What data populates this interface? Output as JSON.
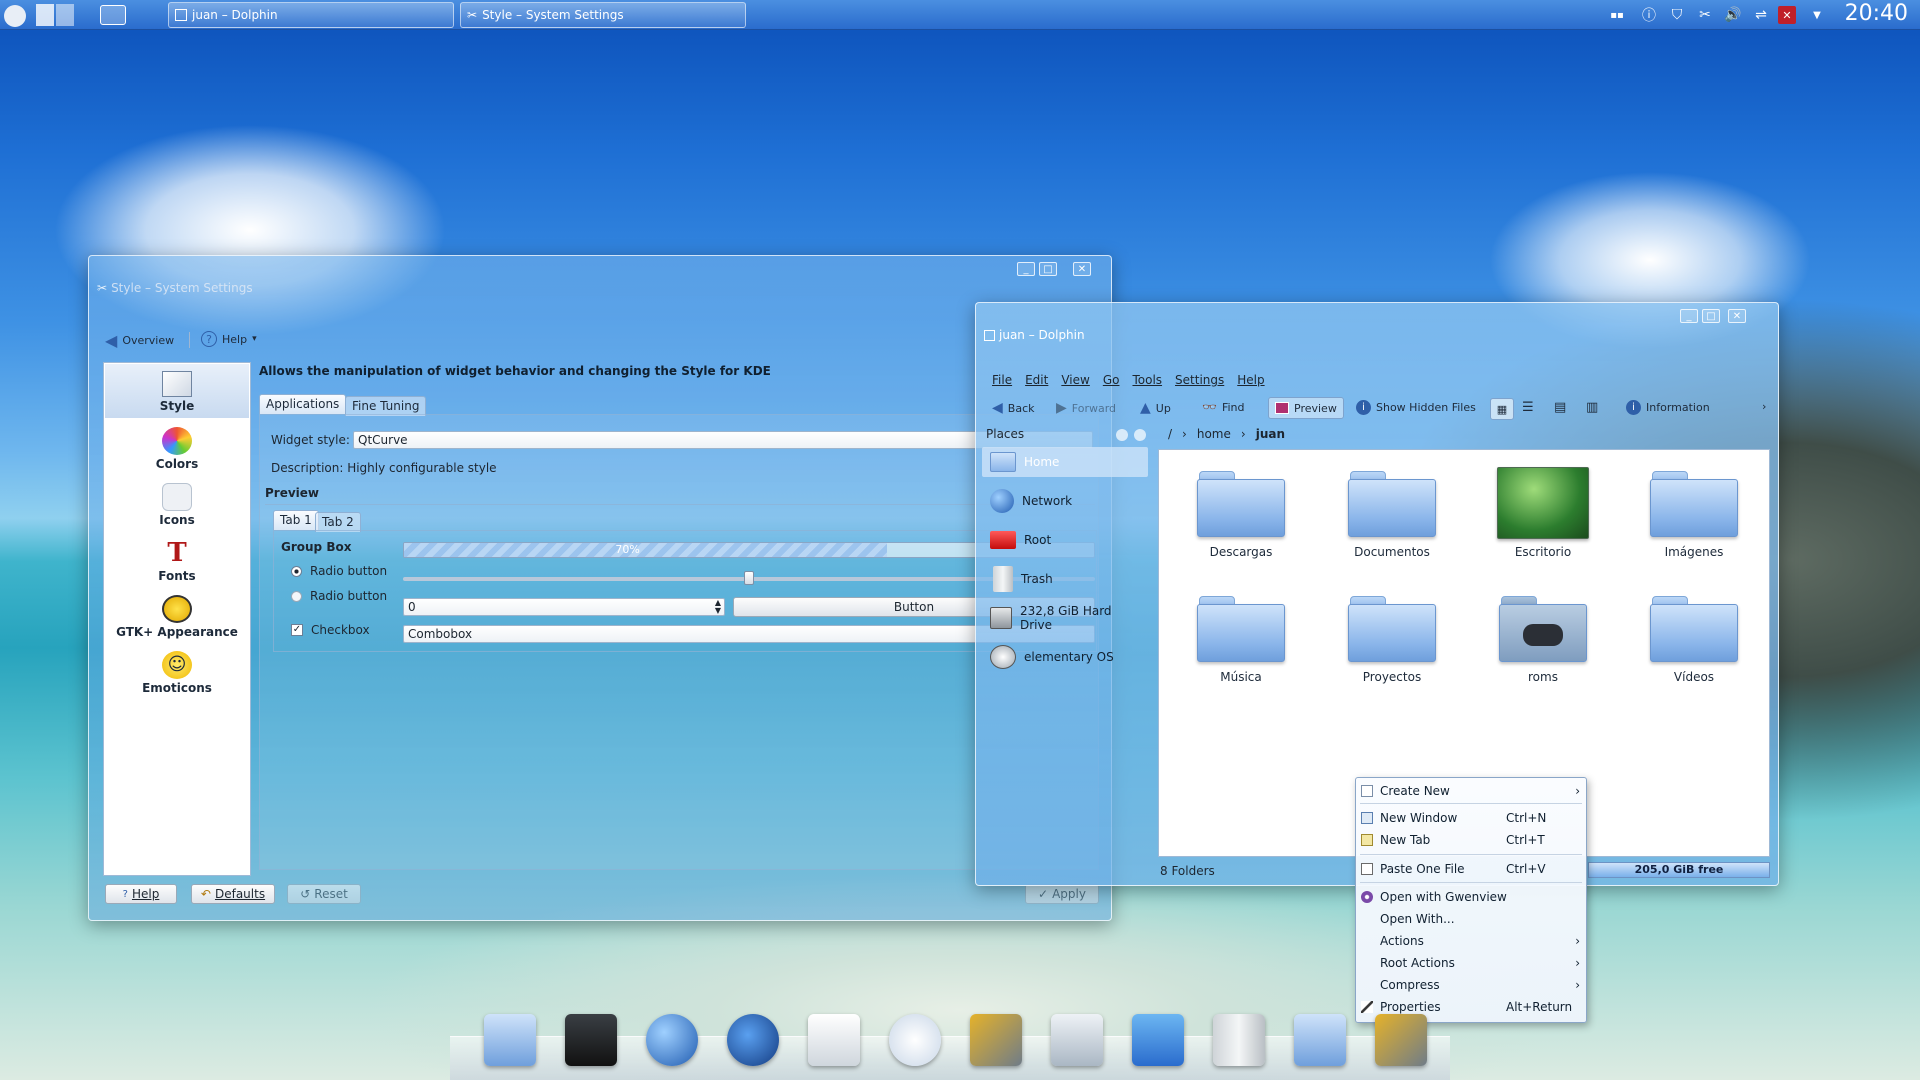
{
  "panel": {
    "tasks": [
      {
        "label": "juan – Dolphin"
      },
      {
        "label": "Style – System Settings"
      }
    ],
    "clock": "20:40"
  },
  "settings": {
    "title": "Style – System Settings",
    "toolbar": {
      "overview": "Overview",
      "help": "Help"
    },
    "categories": [
      {
        "label": "Style",
        "icon": "style-icon"
      },
      {
        "label": "Colors",
        "icon": "colors-icon"
      },
      {
        "label": "Icons",
        "icon": "icons-icon"
      },
      {
        "label": "Fonts",
        "icon": "fonts-icon"
      },
      {
        "label": "GTK+ Appearance",
        "icon": "gtk-icon"
      },
      {
        "label": "Emoticons",
        "icon": "emoticons-icon"
      }
    ],
    "header": "Allows the manipulation of widget behavior and changing the Style for KDE",
    "tabs": [
      "Applications",
      "Fine Tuning"
    ],
    "widget_style_label": "Widget style:",
    "widget_style_value": "QtCurve",
    "description": "Description: Highly configurable style",
    "preview_label": "Preview",
    "preview": {
      "tabs": [
        "Tab 1",
        "Tab 2"
      ],
      "groupbox": "Group Box",
      "radio1": "Radio button",
      "radio2": "Radio button",
      "checkbox": "Checkbox",
      "progress_text": "70%",
      "progress": 0.7,
      "slider": 0.5,
      "spin_value": "0",
      "button": "Button",
      "combobox": "Combobox"
    },
    "bottom": {
      "help": "Help",
      "defaults": "Defaults",
      "reset": "Reset",
      "apply": "Apply"
    }
  },
  "dolphin": {
    "title": "juan – Dolphin",
    "menu": [
      "File",
      "Edit",
      "View",
      "Go",
      "Tools",
      "Settings",
      "Help"
    ],
    "toolbar": {
      "back": "Back",
      "forward": "Forward",
      "up": "Up",
      "find": "Find",
      "preview": "Preview",
      "hidden": "Show Hidden Files",
      "information": "Information"
    },
    "places_title": "Places",
    "places": [
      "Home",
      "Network",
      "Root",
      "Trash",
      "232,8 GiB Hard Drive",
      "elementary OS"
    ],
    "breadcrumb": [
      "/",
      "home",
      "juan"
    ],
    "folders": [
      "Descargas",
      "Documentos",
      "Escritorio",
      "Imágenes",
      "Música",
      "Proyectos",
      "roms",
      "Vídeos"
    ],
    "status_left": "8 Folders",
    "status_right": "205,0 GiB free"
  },
  "context_menu": {
    "items": [
      {
        "label": "Create New",
        "shortcut": "",
        "submenu": true
      },
      {
        "label": "New Window",
        "shortcut": "Ctrl+N",
        "submenu": false
      },
      {
        "label": "New Tab",
        "shortcut": "Ctrl+T",
        "submenu": false
      },
      {
        "label": "Paste One File",
        "shortcut": "Ctrl+V",
        "submenu": false
      },
      {
        "label": "Open with Gwenview",
        "shortcut": "",
        "submenu": false
      },
      {
        "label": "Open With...",
        "shortcut": "",
        "submenu": false
      },
      {
        "label": "Actions",
        "shortcut": "",
        "submenu": true
      },
      {
        "label": "Root Actions",
        "shortcut": "",
        "submenu": true
      },
      {
        "label": "Compress",
        "shortcut": "",
        "submenu": true
      },
      {
        "label": "Properties",
        "shortcut": "Alt+Return",
        "submenu": false
      }
    ],
    "arrow": "›"
  },
  "dock": [
    "home-folder",
    "terminal",
    "globe",
    "kde-eagle",
    "text-editor",
    "rekonq",
    "system-tools",
    "window-settings",
    "cursor",
    "trash",
    "file-cabinet",
    "settings-tools"
  ],
  "colors": {
    "accent": "#2a6ccd",
    "progress": "#8fc0ee",
    "selection": "#d4e4f7"
  }
}
